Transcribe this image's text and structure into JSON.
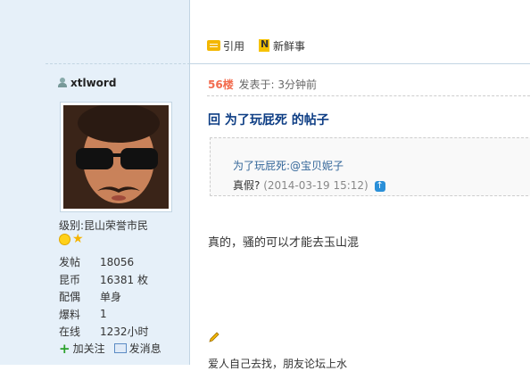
{
  "post_actions": {
    "quote_label": "引用",
    "news_label": "新鲜事"
  },
  "user": {
    "name": "xtlword",
    "level_label": "级别:",
    "level_value": "昆山荣誉市民",
    "stats": [
      {
        "key": "发帖",
        "value": "18056"
      },
      {
        "key": "昆币",
        "value": "16381 枚"
      },
      {
        "key": "配偶",
        "value": "单身"
      },
      {
        "key": "爆料",
        "value": "1"
      },
      {
        "key": "在线",
        "value": "1232小时"
      }
    ],
    "follow_label": "加关注",
    "message_label": "发消息"
  },
  "post": {
    "floor": "56楼",
    "time": "发表于: 3分钟前",
    "title": "回 为了玩屁死 的帖子",
    "quote_link": "为了玩屁死:@宝贝妮子",
    "quote_text": "真假?",
    "quote_time": "(2014-03-19 15:12)",
    "content": "真的，骚的可以才能去玉山混",
    "signature": "爱人自己去找，朋友论坛上水"
  },
  "colors": {
    "sidebar_bg": "#e6f0f9",
    "title_blue": "#0d3d84",
    "floor_orange": "#f26c4f",
    "link_blue": "#336699"
  }
}
